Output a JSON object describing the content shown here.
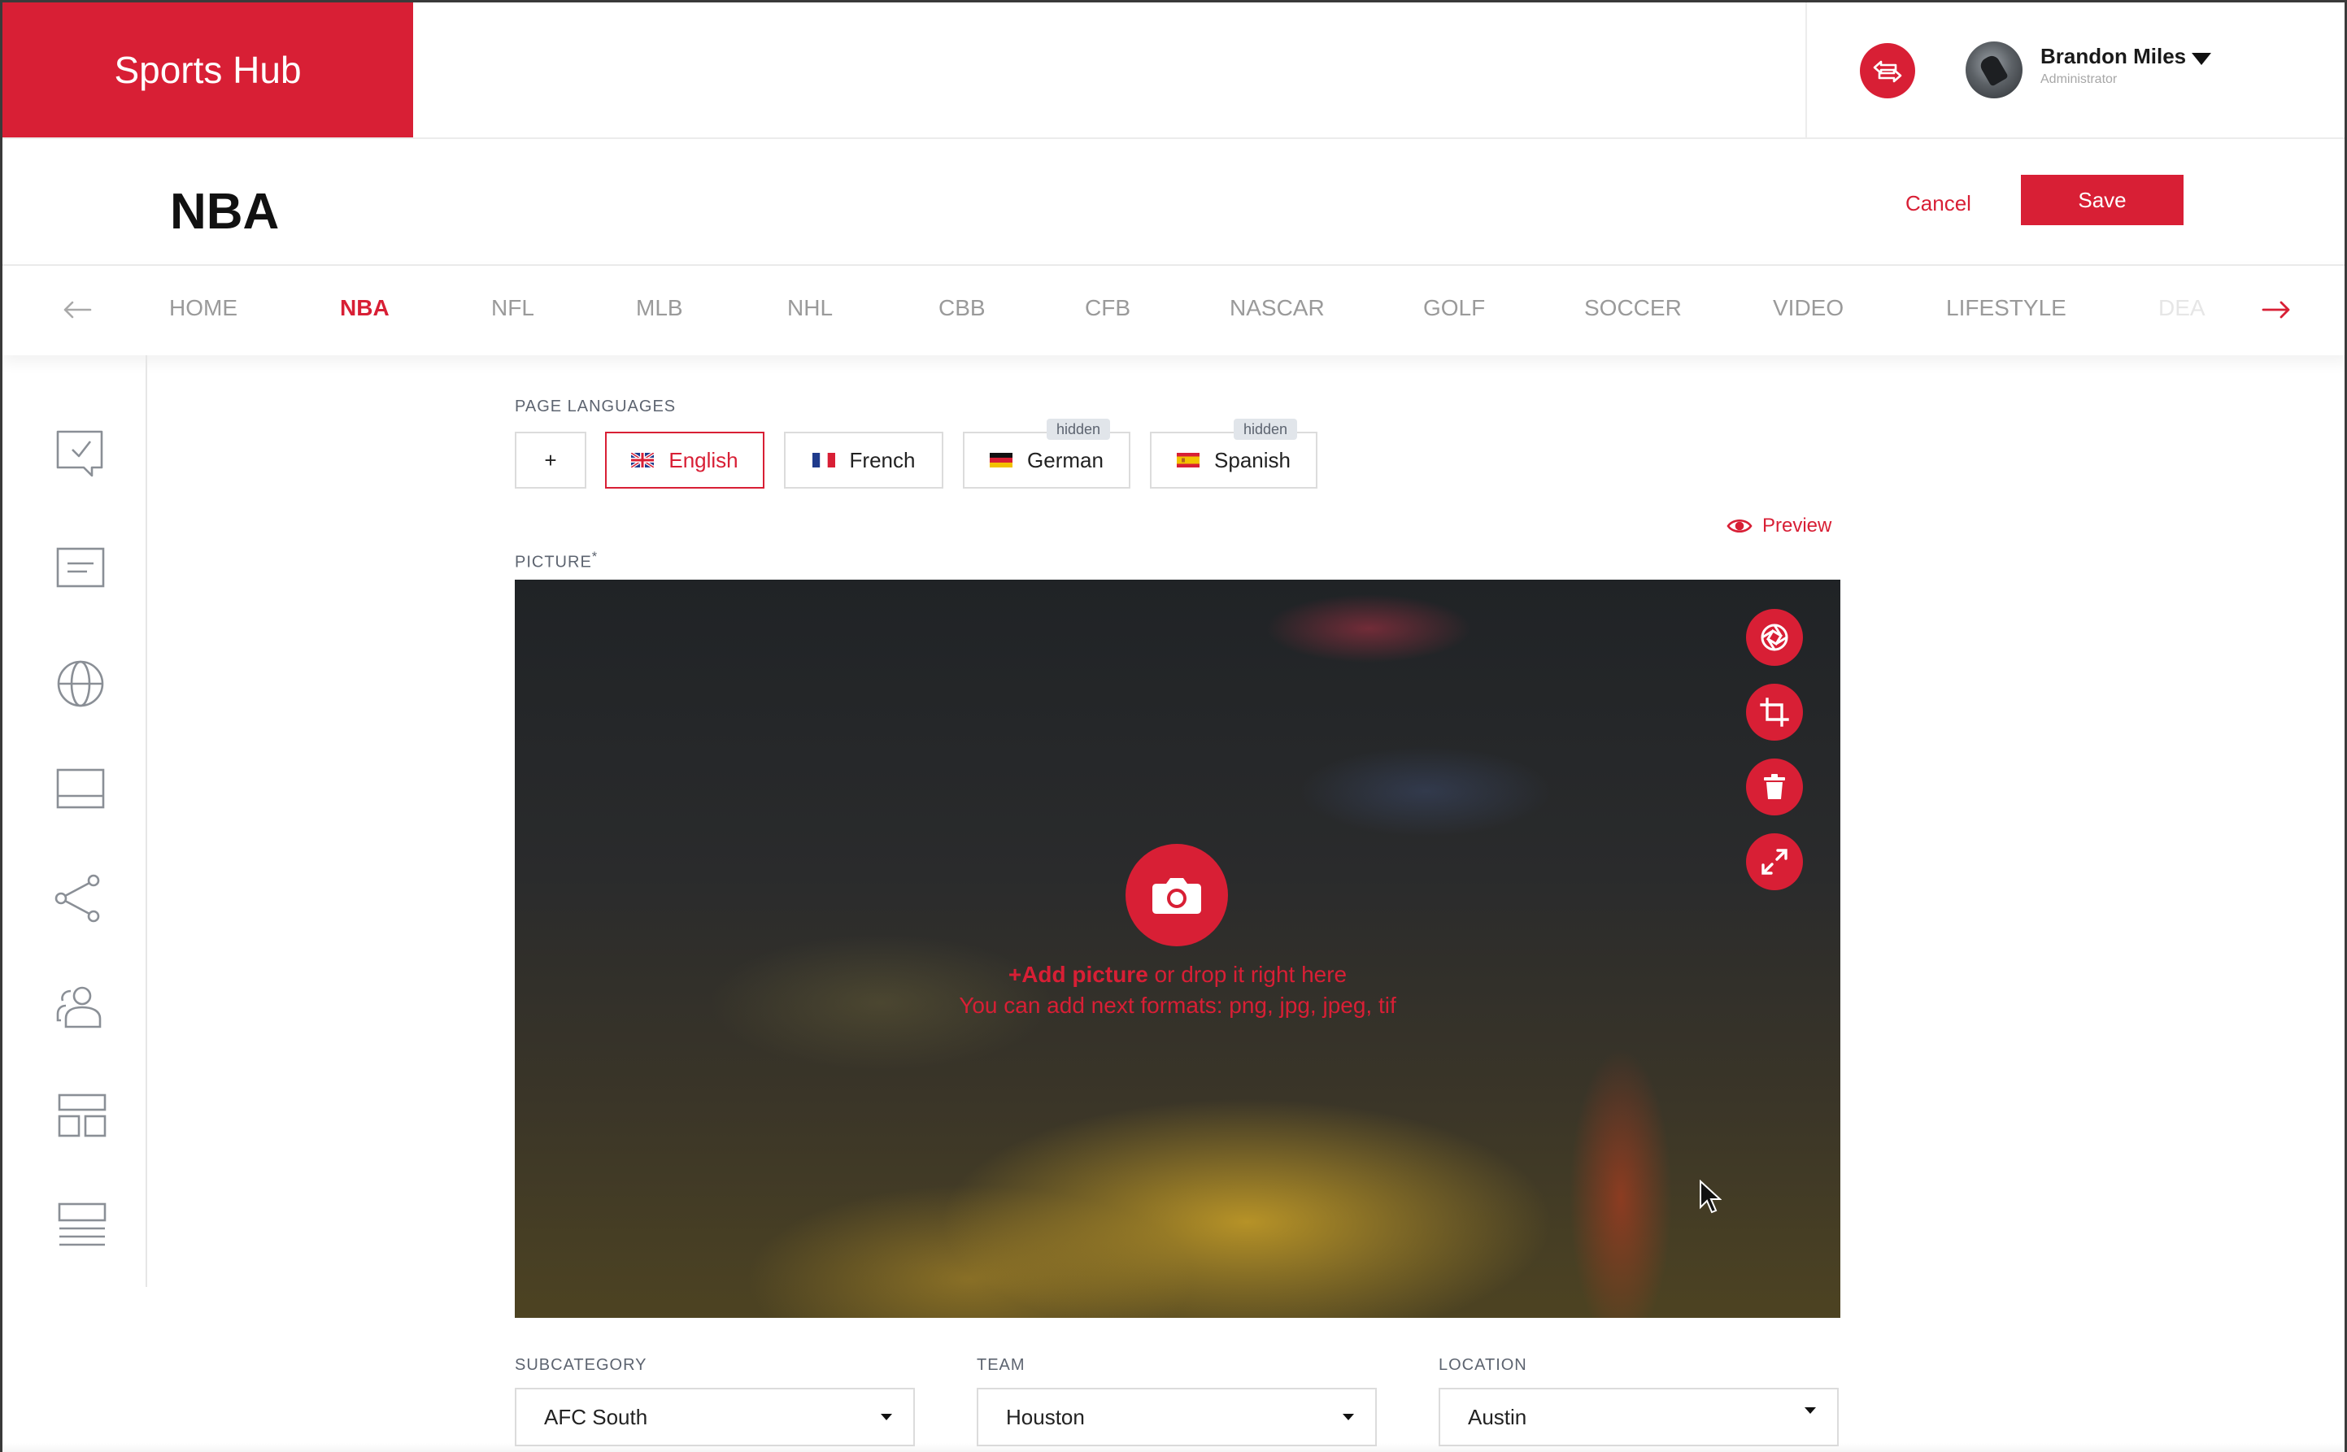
{
  "app": {
    "title": "Sports Hub"
  },
  "user": {
    "name": "Brandon Miles",
    "role": "Administrator"
  },
  "page": {
    "title": "NBA",
    "cancel_label": "Cancel",
    "save_label": "Save"
  },
  "nav": {
    "tabs": [
      {
        "label": "HOME"
      },
      {
        "label": "NBA",
        "active": true
      },
      {
        "label": "NFL"
      },
      {
        "label": "MLB"
      },
      {
        "label": "NHL"
      },
      {
        "label": "CBB"
      },
      {
        "label": "CFB"
      },
      {
        "label": "NASCAR"
      },
      {
        "label": "GOLF"
      },
      {
        "label": "SOCCER"
      },
      {
        "label": "VIDEO"
      },
      {
        "label": "LIFESTYLE"
      },
      {
        "label": "DEA"
      }
    ]
  },
  "languages": {
    "section_label": "PAGE LANGUAGES",
    "add_label": "+",
    "items": [
      {
        "label": "English",
        "flag": "uk-flag",
        "active": true
      },
      {
        "label": "French",
        "flag": "france-flag"
      },
      {
        "label": "German",
        "flag": "germany-flag",
        "tag": "hidden"
      },
      {
        "label": "Spanish",
        "flag": "spain-flag",
        "tag": "hidden"
      }
    ]
  },
  "preview_label": "Preview",
  "picture": {
    "label": "PICTURE",
    "required_mark": "*",
    "add_link": "+Add picture",
    "drop_text": " or drop it right here",
    "formats_text": "You can add next formats: png, jpg, jpeg, tif",
    "tools": [
      "aperture-icon",
      "crop-icon",
      "trash-icon",
      "expand-icon"
    ]
  },
  "fields": {
    "subcategory": {
      "label": "SUBCATEGORY",
      "value": "AFC South"
    },
    "team": {
      "label": "TEAM",
      "value": "Houston"
    },
    "location": {
      "label": "LOCATION",
      "value": "Austin"
    }
  },
  "colors": {
    "accent": "#d81f35",
    "muted_text": "#9a9a9a"
  }
}
